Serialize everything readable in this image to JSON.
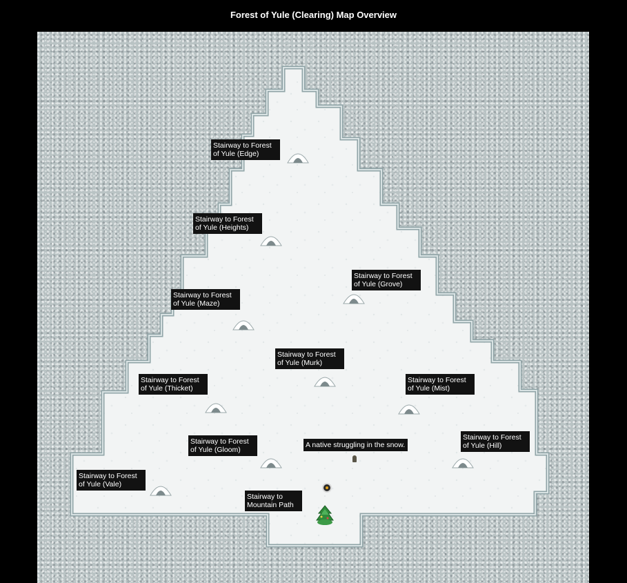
{
  "title": "Forest of Yule (Clearing) Map Overview",
  "labels": [
    {
      "id": "edge",
      "line1": "Stairway to Forest",
      "line2": "of Yule (Edge)"
    },
    {
      "id": "heights",
      "line1": "Stairway to Forest",
      "line2": "of Yule (Heights)"
    },
    {
      "id": "grove",
      "line1": "Stairway to Forest",
      "line2": "of Yule (Grove)"
    },
    {
      "id": "maze",
      "line1": "Stairway to Forest",
      "line2": "of Yule (Maze)"
    },
    {
      "id": "murk",
      "line1": "Stairway to Forest",
      "line2": "of Yule (Murk)"
    },
    {
      "id": "thicket",
      "line1": "Stairway to Forest",
      "line2": "of Yule (Thicket)"
    },
    {
      "id": "mist",
      "line1": "Stairway to Forest",
      "line2": "of Yule (Mist)"
    },
    {
      "id": "gloom",
      "line1": "Stairway to Forest",
      "line2": "of Yule (Gloom)"
    },
    {
      "id": "hill",
      "line1": "Stairway to Forest",
      "line2": "of Yule (Hill)"
    },
    {
      "id": "vale",
      "line1": "Stairway to Forest",
      "line2": "of Yule (Vale)"
    },
    {
      "id": "mountain",
      "line1": "Stairway to",
      "line2": "Mountain Path"
    }
  ],
  "npc_label": "A native struggling in the snow.",
  "icons": {
    "portal": "snow-stairway-icon",
    "npc": "native-npc-icon",
    "player": "player-marker-icon",
    "tree": "pine-tree-icon"
  },
  "colors": {
    "background": "#000000",
    "snow_floor": "#f3f5f5",
    "rock_wall": "#b9c3c4",
    "label_bg": "#121212",
    "label_text": "#ffffff"
  }
}
